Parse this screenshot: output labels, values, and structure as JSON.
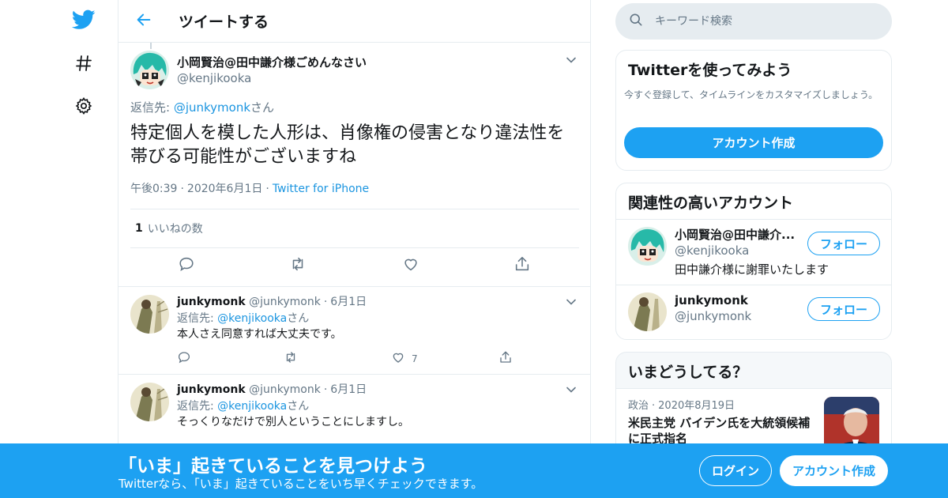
{
  "nav": {
    "logo_icon": "twitter-bird-icon",
    "explore_icon": "hashtag-icon",
    "settings_icon": "gear-icon"
  },
  "header": {
    "title": "ツイートする",
    "back_icon": "arrow-left-icon"
  },
  "main_tweet": {
    "display_name": "小岡賢治@田中謙介様ごめんなさい",
    "handle": "@kenjikooka",
    "reply_prefix": "返信先: ",
    "reply_mention": "@junkymonk",
    "reply_suffix": "さん",
    "text": "特定個人を模した人形は、肖像権の侵害となり違法性を帯びる可能性がございますね",
    "time": "午後0:39",
    "date": "2020年6月1日",
    "source": "Twitter for iPhone",
    "likes_count": "1",
    "likes_label": "いいねの数"
  },
  "replies": [
    {
      "display_name": "junkymonk",
      "handle": "@junkymonk",
      "date": "6月1日",
      "reply_prefix": "返信先: ",
      "reply_mention": "@kenjikooka",
      "reply_suffix": "さん",
      "text": "本人さえ同意すれば大丈夫です。",
      "like_count": "7"
    },
    {
      "display_name": "junkymonk",
      "handle": "@junkymonk",
      "date": "6月1日",
      "reply_prefix": "返信先: ",
      "reply_mention": "@kenjikooka",
      "reply_suffix": "さん",
      "text": "そっくりなだけで別人ということにしますし。",
      "like_count": ""
    }
  ],
  "search": {
    "placeholder": "キーワード検索"
  },
  "signup_card": {
    "title": "Twitterを使ってみよう",
    "desc": "今すぐ登録して、タイムラインをカスタマイズしましょう。",
    "button": "アカウント作成"
  },
  "related": {
    "title": "関連性の高いアカウント",
    "accounts": [
      {
        "name": "小岡賢治@田中謙介...",
        "handle": "@kenjikooka",
        "bio": "田中謙介様に謝罪いたします",
        "follow": "フォロー"
      },
      {
        "name": "junkymonk",
        "handle": "@junkymonk",
        "bio": "",
        "follow": "フォロー"
      }
    ]
  },
  "trends": {
    "title": "いまどうしてる？",
    "items": [
      {
        "category": "政治",
        "date": "2020年8月19日",
        "headline": "米民主党 バイデン氏を大統領候補に正式指名"
      }
    ]
  },
  "banner": {
    "title": "「いま」起きていることを見つけよう",
    "subtitle": "Twitterなら、「いま」起きていることをいち早くチェックできます。",
    "login": "ログイン",
    "signup": "アカウント作成"
  },
  "colors": {
    "brand": "#1da1f2",
    "link": "#1b95e0",
    "muted": "#657786",
    "border": "#e6ecf0"
  }
}
